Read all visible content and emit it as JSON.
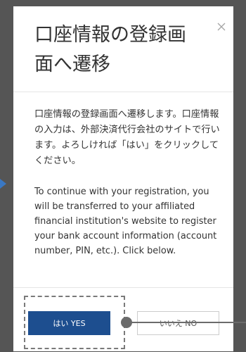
{
  "modal": {
    "title": "口座情報の登録画面へ遷移",
    "body_ja": "口座情報の登録画面へ遷移します。口座情報の入力は、外部決済代行会社のサイトで行います。よろしければ「はい」をクリックしてください。",
    "body_en": "To continue with your registration, you will be transferred to your affiliated financial institution's website to register your bank account information (account number, PIN, etc.). Click below.",
    "yes_label": "はい YES",
    "no_label": "いいえ NO"
  },
  "icons": {
    "close": "close-icon",
    "side_arrow": "chevron-right-icon"
  },
  "colors": {
    "overlay": "#555555",
    "primary_button": "#1d4e8f",
    "side_arrow": "#3a78c4",
    "annotation": "#6b6b6b"
  }
}
